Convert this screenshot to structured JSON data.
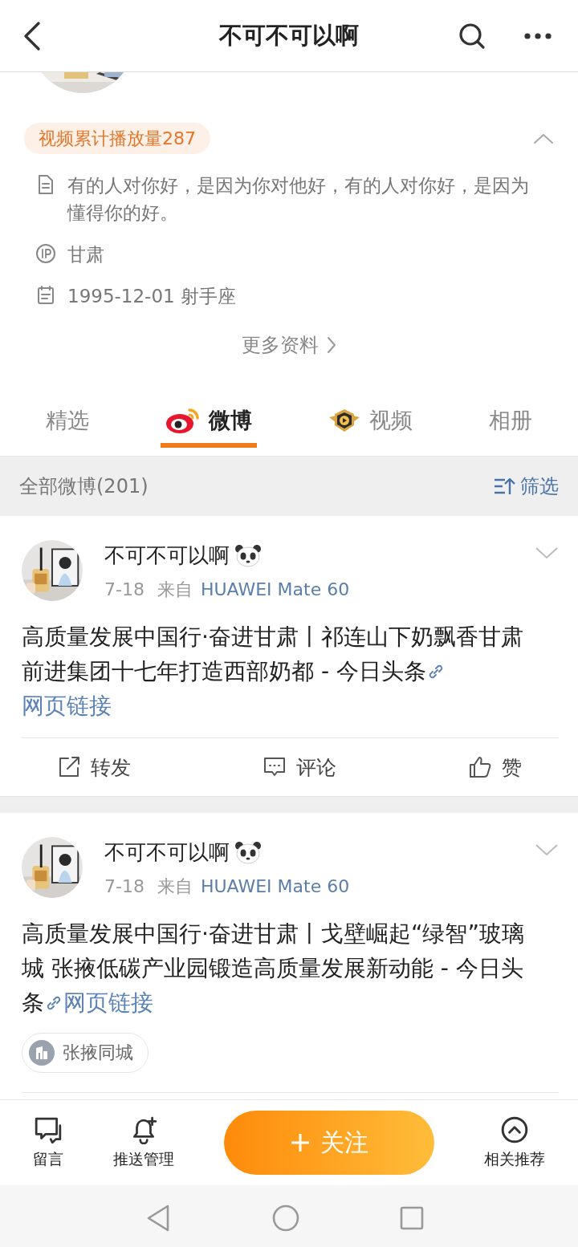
{
  "header": {
    "title": "不可不可以啊"
  },
  "profile": {
    "video_badge": "视频累计播放量287",
    "expanded": true,
    "details": [
      {
        "kind": "bio",
        "text": "有的人对你好，是因为你对他好，有的人对你好，是因为懂得你的好。"
      },
      {
        "kind": "ip",
        "text": "甘肃"
      },
      {
        "kind": "birthday",
        "text": "1995-12-01 射手座"
      }
    ],
    "more": "更多资料"
  },
  "tabs": [
    {
      "label": "精选",
      "selected": false,
      "kind": "text"
    },
    {
      "label": "微博",
      "selected": true,
      "kind": "weibo"
    },
    {
      "label": "视频",
      "selected": false,
      "kind": "video"
    },
    {
      "label": "相册",
      "selected": false,
      "kind": "text"
    }
  ],
  "feed_header": {
    "title": "全部微博(201)",
    "filter": "筛选"
  },
  "posts": [
    {
      "author": "不可不可以啊",
      "date": "7-18",
      "source_prefix": "来自",
      "source": "HUAWEI Mate 60",
      "text": "高质量发展中国行·奋进甘肃丨祁连山下奶飘香甘肃前进集团十七年打造西部奶都 - 今日头条",
      "link": "网页链接",
      "actions": [
        "转发",
        "评论",
        "赞"
      ]
    },
    {
      "author": "不可不可以啊",
      "date": "7-18",
      "source_prefix": "来自",
      "source": "HUAWEI Mate 60",
      "text": "高质量发展中国行·奋进甘肃丨戈壁崛起“绿智”玻璃城 张掖低碳产业园锻造高质量发展新动能 - 今日头条",
      "link": "网页链接",
      "location": "张掖同城"
    }
  ],
  "bottom_bar": [
    {
      "label": "留言",
      "kind": "message"
    },
    {
      "label": "推送管理",
      "kind": "bell"
    },
    {
      "label": "关注",
      "kind": "follow"
    },
    {
      "label": "相关推荐",
      "kind": "recommend"
    }
  ]
}
